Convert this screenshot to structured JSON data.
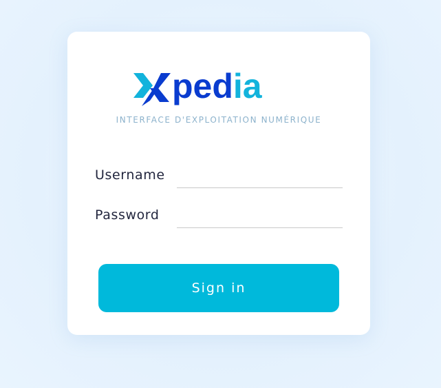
{
  "brand": {
    "logo_text_dark": "xped",
    "logo_text_light": "ia",
    "subtitle": "INTERFACE D'EXPLOITATION NUMÉRIQUE",
    "colors": {
      "dark_blue": "#0a3ccf",
      "light_blue": "#12b3dc",
      "accent_button": "#00b9db"
    }
  },
  "login_form": {
    "username_label": "Username",
    "username_value": "",
    "password_label": "Password",
    "password_value": "",
    "submit_label": "Sign in"
  }
}
